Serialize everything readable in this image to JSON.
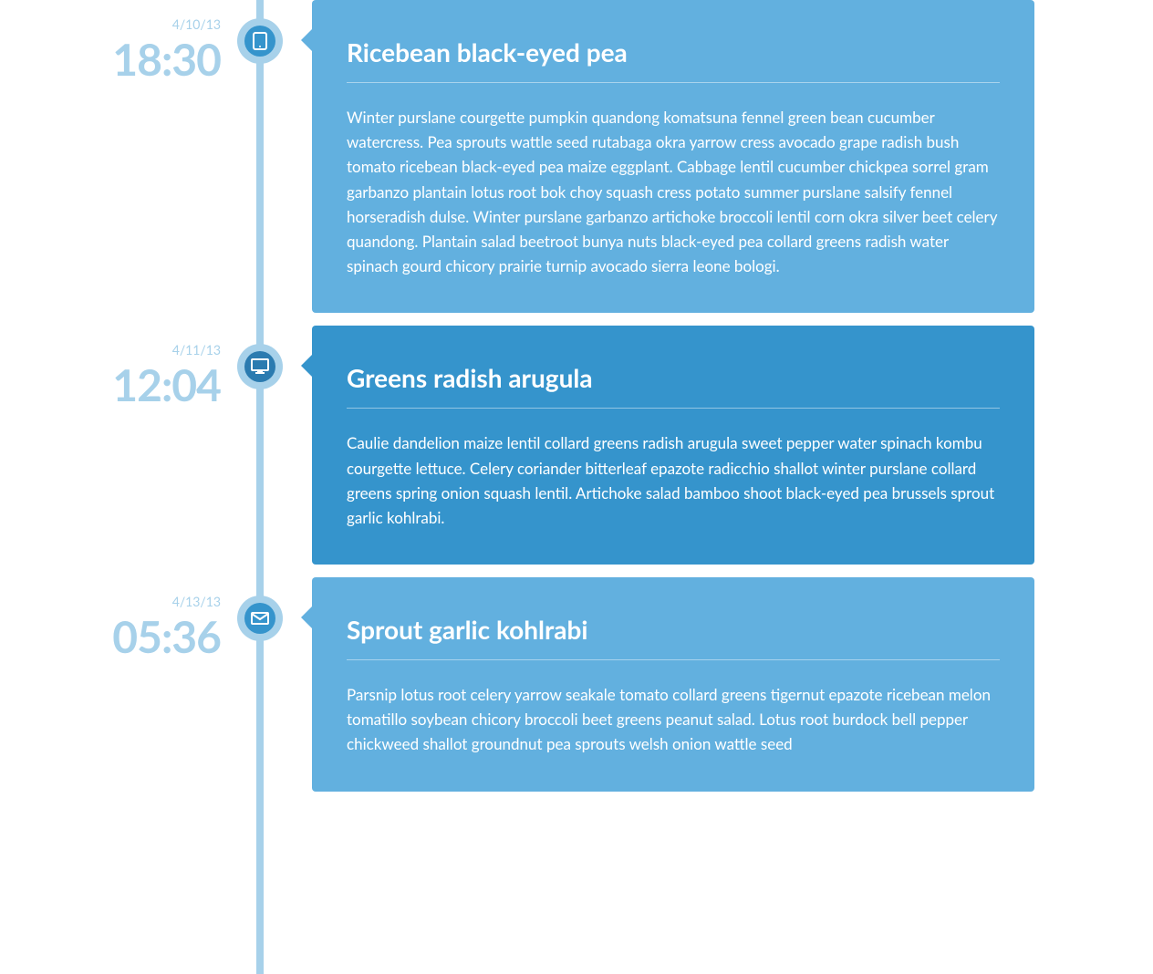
{
  "timeline": [
    {
      "date": "4/10/13",
      "time": "18:30",
      "icon": "tablet-icon",
      "title": "Ricebean black-eyed pea",
      "body": "Winter purslane courgette pumpkin quandong komatsuna fennel green bean cucumber watercress. Pea sprouts wattle seed rutabaga okra yarrow cress avocado grape radish bush tomato ricebean black-eyed pea maize eggplant. Cabbage lentil cucumber chickpea sorrel gram garbanzo plantain lotus root bok choy squash cress potato summer purslane salsify fennel horseradish dulse. Winter purslane garbanzo artichoke broccoli lentil corn okra silver beet celery quandong. Plantain salad beetroot bunya nuts black-eyed pea collard greens radish water spinach gourd chicory prairie turnip avocado sierra leone bologi."
    },
    {
      "date": "4/11/13",
      "time": "12:04",
      "icon": "desktop-icon",
      "title": "Greens radish arugula",
      "body": "Caulie dandelion maize lentil collard greens radish arugula sweet pepper water spinach kombu courgette lettuce. Celery coriander bitterleaf epazote radicchio shallot winter purslane collard greens spring onion squash lentil. Artichoke salad bamboo shoot black-eyed pea brussels sprout garlic kohlrabi."
    },
    {
      "date": "4/13/13",
      "time": "05:36",
      "icon": "mail-icon",
      "title": "Sprout garlic kohlrabi",
      "body": "Parsnip lotus root celery yarrow seakale tomato collard greens tigernut epazote ricebean melon tomatillo soybean chicory broccoli beet greens peanut salad. Lotus root burdock bell pepper chickweed shallot groundnut pea sprouts welsh onion wattle seed"
    }
  ]
}
